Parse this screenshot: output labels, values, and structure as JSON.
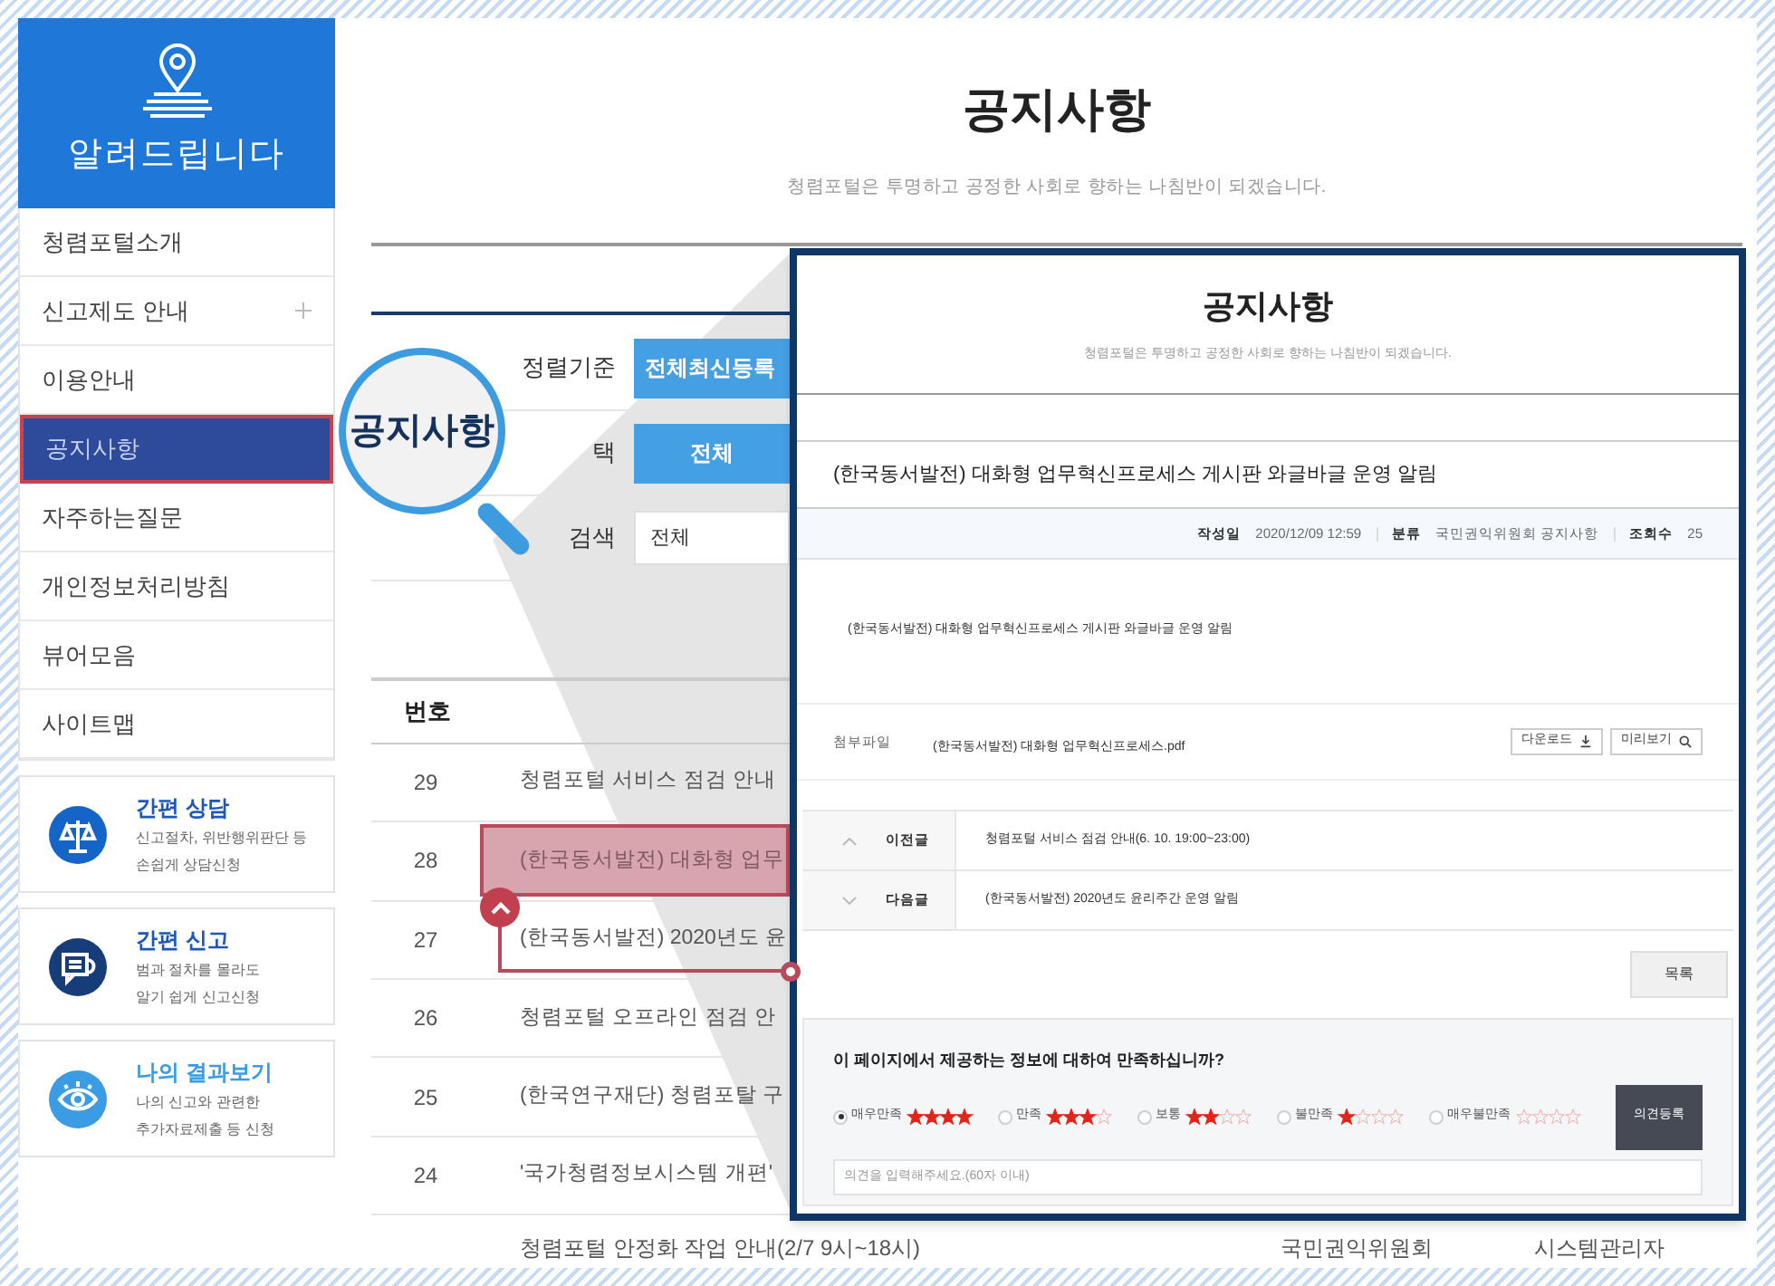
{
  "sidebar": {
    "header": "알려드립니다",
    "items": [
      {
        "label": "청렴포털소개",
        "expandable": false,
        "selected": false
      },
      {
        "label": "신고제도 안내",
        "expandable": true,
        "selected": false
      },
      {
        "label": "이용안내",
        "expandable": false,
        "selected": false
      },
      {
        "label": "공지사항",
        "expandable": false,
        "selected": true
      },
      {
        "label": "자주하는질문",
        "expandable": false,
        "selected": false
      },
      {
        "label": "개인정보처리방침",
        "expandable": false,
        "selected": false
      },
      {
        "label": "뷰어모음",
        "expandable": false,
        "selected": false
      },
      {
        "label": "사이트맵",
        "expandable": false,
        "selected": false
      }
    ],
    "cards": [
      {
        "kind": "scale",
        "title": "간편 상담",
        "lines": [
          "신고절차, 위반행위판단 등",
          "손쉽게 상담신청"
        ],
        "color": "#1565c9"
      },
      {
        "kind": "chat",
        "title": "간편 신고",
        "lines": [
          "범과 절차를 몰라도",
          "알기 쉽게 신고신청"
        ],
        "color": "#163c7a"
      },
      {
        "kind": "eye",
        "title": "나의 결과보기",
        "lines": [
          "나의 신고와 관련한",
          "추가자료제출 등 신청"
        ],
        "color": "#3b9be3"
      }
    ]
  },
  "page": {
    "title": "공지사항",
    "subtitle": "청렴포털은 투명하고 공정한 사회로 향하는 나침반이 되겠습니다."
  },
  "filters": [
    {
      "label": "정렬기준",
      "kind": "button",
      "value": "전체최신등록"
    },
    {
      "label": "택",
      "kind": "button",
      "value": "전체"
    },
    {
      "label": "검색",
      "kind": "select",
      "value": "전체"
    }
  ],
  "table": {
    "columns": [
      "번호"
    ],
    "rows": [
      {
        "number": "29",
        "title": "청렴포털 서비스 점검 안내",
        "selected": false
      },
      {
        "number": "28",
        "title": "(한국동서발전) 대화형 업무",
        "selected": true
      },
      {
        "number": "27",
        "title": "(한국동서발전) 2020년도 윤",
        "selected": false
      },
      {
        "number": "26",
        "title": "청렴포털 오프라인 점검 안",
        "selected": false
      },
      {
        "number": "25",
        "title": "(한국연구재단) 청렴포탈 구",
        "selected": false
      },
      {
        "number": "24",
        "title": "'국가청렴정보시스템 개편'",
        "selected": false
      }
    ],
    "last_row": {
      "title": "청렴포털 안정화 작업 안내(2/7 9시~18시)",
      "department": "국민권익위원회",
      "author": "시스템관리자"
    }
  },
  "magnifier": {
    "text": "공지사항"
  },
  "detail": {
    "title": "공지사항",
    "subtitle": "청렴포털은 투명하고 공정한 사회로 향하는 나침반이 되겠습니다.",
    "post_title": "(한국동서발전) 대화형 업무혁신프로세스 게시판 와글바글 운영 알림",
    "meta": [
      {
        "label": "작성일",
        "value": "2020/12/09 12:59"
      },
      {
        "label": "분류",
        "value": "국민권익위원회 공지사항"
      },
      {
        "label": "조회수",
        "value": "25"
      }
    ],
    "body": "(한국동서발전) 대화형 업무혁신프로세스 게시판 와글바글 운영 알림",
    "attachment": {
      "label": "첨부파일",
      "file": "(한국동서발전) 대화형 업무혁신프로세스.pdf",
      "buttons": [
        {
          "kind": "download",
          "label": "다운로드"
        },
        {
          "kind": "preview",
          "label": "미리보기"
        }
      ]
    },
    "nav": [
      {
        "kind": "prev",
        "label": "이전글",
        "title": "청렴포털 서비스 점검 안내(6. 10. 19:00~23:00)"
      },
      {
        "kind": "next",
        "label": "다음글",
        "title": "(한국동서발전) 2020년도 윤리주간 운영 알림"
      }
    ],
    "list_button": "목록",
    "survey": {
      "question": "이 페이지에서 제공하는 정보에 대하여 만족하십니까?",
      "options": [
        {
          "label": "매우만족",
          "stars": 4,
          "selected": true
        },
        {
          "label": "만족",
          "stars": 3,
          "selected": false
        },
        {
          "label": "보통",
          "stars": 2,
          "selected": false
        },
        {
          "label": "불만족",
          "stars": 1,
          "selected": false
        },
        {
          "label": "매우불만족",
          "stars": 0,
          "selected": false
        }
      ],
      "submit": "의견등록",
      "placeholder": "의견을 입력해주세요.(60자 이내)"
    }
  }
}
